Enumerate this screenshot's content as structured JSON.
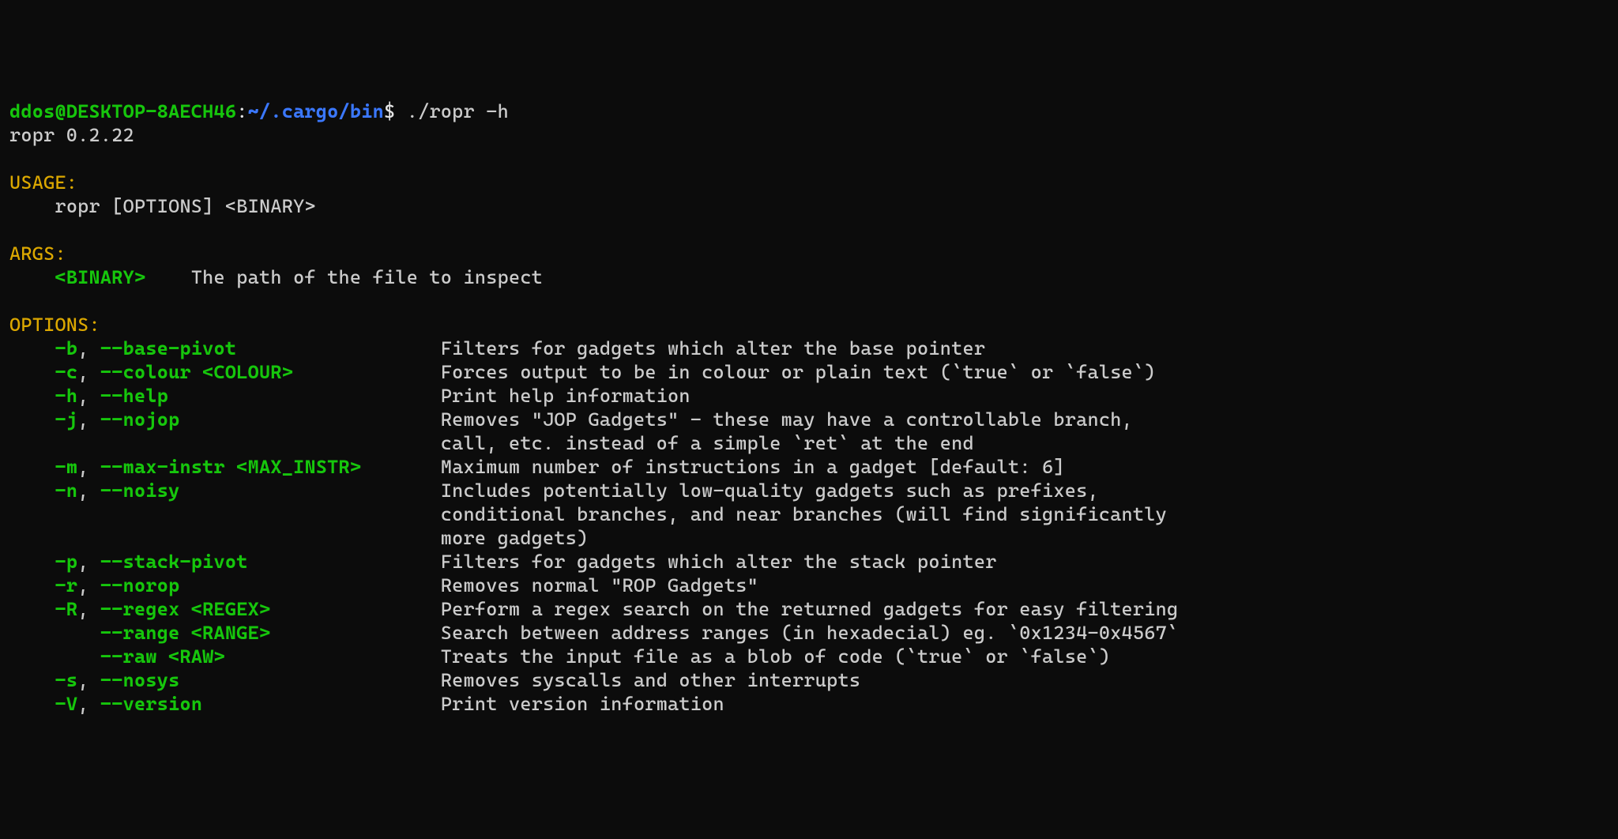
{
  "prompt": {
    "user": "ddos@DESKTOP-8AECH46",
    "colon": ":",
    "path": "~/.cargo/bin",
    "dollar": "$",
    "command": " ./ropr -h"
  },
  "version_line": "ropr 0.2.22",
  "usage": {
    "header": "USAGE:",
    "line": "ropr [OPTIONS] <BINARY>"
  },
  "args": {
    "header": "ARGS:",
    "name": "<BINARY>",
    "desc": "The path of the file to inspect"
  },
  "options_header": "OPTIONS:",
  "options": [
    {
      "short": "-b",
      "sep": ", ",
      "long": "--base-pivot",
      "arg": "",
      "desc": [
        "Filters for gadgets which alter the base pointer"
      ]
    },
    {
      "short": "-c",
      "sep": ", ",
      "long": "--colour ",
      "arg": "<COLOUR>",
      "desc": [
        "Forces output to be in colour or plain text (`true` or `false`)"
      ]
    },
    {
      "short": "-h",
      "sep": ", ",
      "long": "--help",
      "arg": "",
      "desc": [
        "Print help information"
      ]
    },
    {
      "short": "-j",
      "sep": ", ",
      "long": "--nojop",
      "arg": "",
      "desc": [
        "Removes \"JOP Gadgets\" - these may have a controllable branch,",
        "call, etc. instead of a simple `ret` at the end"
      ]
    },
    {
      "short": "-m",
      "sep": ", ",
      "long": "--max-instr ",
      "arg": "<MAX_INSTR>",
      "desc": [
        "Maximum number of instructions in a gadget [default: 6]"
      ]
    },
    {
      "short": "-n",
      "sep": ", ",
      "long": "--noisy",
      "arg": "",
      "desc": [
        "Includes potentially low-quality gadgets such as prefixes,",
        "conditional branches, and near branches (will find significantly",
        "more gadgets)"
      ]
    },
    {
      "short": "-p",
      "sep": ", ",
      "long": "--stack-pivot",
      "arg": "",
      "desc": [
        "Filters for gadgets which alter the stack pointer"
      ]
    },
    {
      "short": "-r",
      "sep": ", ",
      "long": "--norop",
      "arg": "",
      "desc": [
        "Removes normal \"ROP Gadgets\""
      ]
    },
    {
      "short": "-R",
      "sep": ", ",
      "long": "--regex ",
      "arg": "<REGEX>",
      "desc": [
        "Perform a regex search on the returned gadgets for easy filtering"
      ]
    },
    {
      "short": "",
      "sep": "    ",
      "long": "--range ",
      "arg": "<RANGE>",
      "desc": [
        "Search between address ranges (in hexadecial) eg. `0x1234-0x4567`"
      ]
    },
    {
      "short": "",
      "sep": "    ",
      "long": "--raw ",
      "arg": "<RAW>",
      "desc": [
        "Treats the input file as a blob of code (`true` or `false`)"
      ]
    },
    {
      "short": "-s",
      "sep": ", ",
      "long": "--nosys",
      "arg": "",
      "desc": [
        "Removes syscalls and other interrupts"
      ]
    },
    {
      "short": "-V",
      "sep": ", ",
      "long": "--version",
      "arg": "",
      "desc": [
        "Print version information"
      ]
    }
  ]
}
